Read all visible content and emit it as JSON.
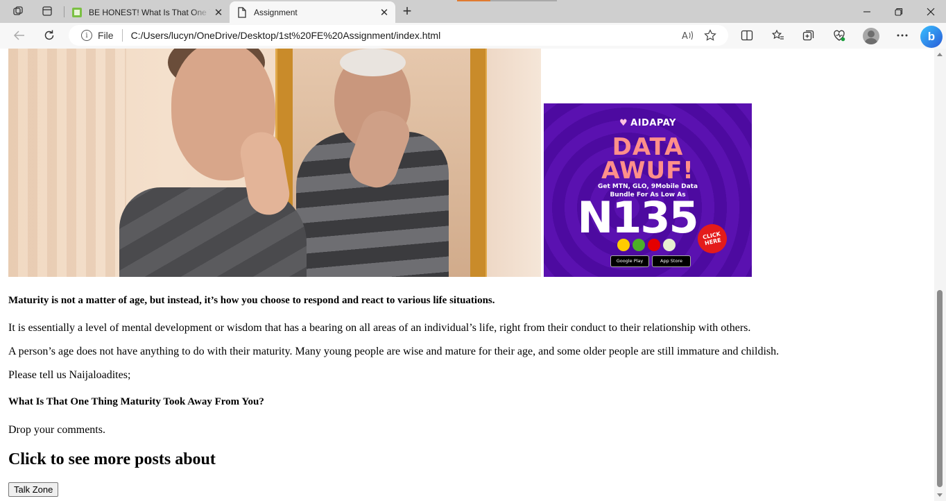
{
  "browser": {
    "tabs": [
      {
        "title": "BE HONEST! What Is That One Thing",
        "active": false,
        "favicon": "page-favicon"
      },
      {
        "title": "Assignment",
        "active": true,
        "favicon": "document-icon"
      }
    ],
    "address": {
      "scheme": "File",
      "url": "C:/Users/lucyn/OneDrive/Desktop/1st%20FE%20Assignment/index.html"
    },
    "accent_color": "#e07a30"
  },
  "article": {
    "lead": "Maturity is not a matter of age, but instead, it’s how you choose to respond and react to various life situations.",
    "para1": "It is essentially a level of mental development or wisdom that has a bearing on all areas of an individual’s life, right from their conduct to their relationship with others.",
    "para2": "A person’s age does not have anything to do with their maturity. Many young people are wise and mature for their age, and some older people are still immature and childish.",
    "para3": "Please tell us Naijaloadites;",
    "question": "What Is That One Thing Maturity Took Away From You?",
    "para4": "Drop your comments.",
    "more_heading": "Click to see more posts about",
    "button_label": "Talk Zone"
  },
  "ad": {
    "brand": "AIDAPAY",
    "headline_line1": "DATA",
    "headline_line2": "AWUF!",
    "sub_line1": "Get MTN, GLO, 9Mobile Data",
    "sub_line2": "Bundle For As Low As",
    "price": "N135",
    "cta_line1": "CLICK",
    "cta_line2": "HERE",
    "store1": "Google Play",
    "store2": "App Store",
    "background_color": "#5a11b0"
  }
}
